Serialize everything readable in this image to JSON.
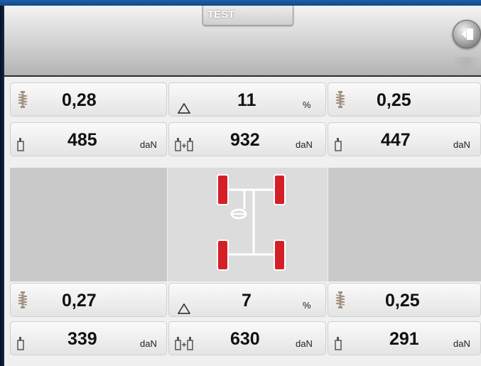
{
  "header": {
    "tab_label": "TEST",
    "exit_icon": "exit-door-icon"
  },
  "front": {
    "left_damping": "0,28",
    "delta": "11",
    "delta_unit": "%",
    "right_damping": "0,25",
    "left_weight": "485",
    "total_weight": "932",
    "right_weight": "447",
    "weight_unit": "daN"
  },
  "rear": {
    "left_damping": "0,27",
    "delta": "7",
    "delta_unit": "%",
    "right_damping": "0,25",
    "left_weight": "339",
    "total_weight": "630",
    "right_weight": "291",
    "weight_unit": "daN"
  },
  "colors": {
    "wheel_red": "#d51f26",
    "header_blue": "#1d5fa8"
  }
}
